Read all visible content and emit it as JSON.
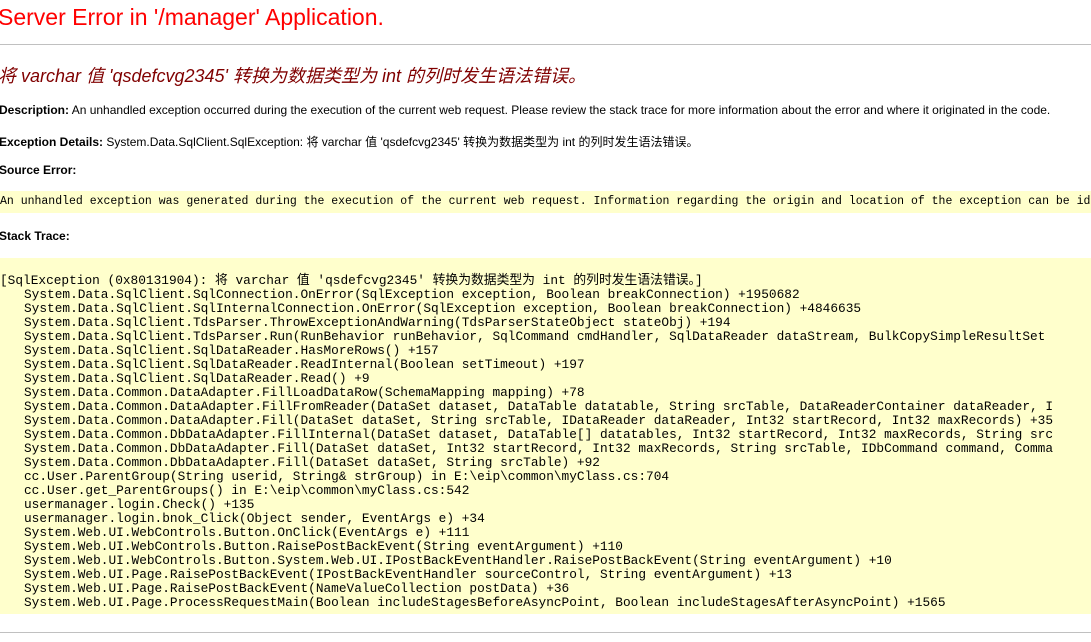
{
  "page": {
    "title": "Server Error in '/manager' Application.",
    "error_heading": "将 varchar 值 'qsdefcvg2345' 转换为数据类型为 int 的列时发生语法错误。",
    "colors": {
      "title": "#ff0000",
      "heading": "#800000",
      "code_background": "#ffffcc",
      "rule": "#c0c0c0"
    }
  },
  "description": {
    "label": "Description:",
    "text": " An unhandled exception occurred during the execution of the current web request. Please review the stack trace for more information about the error and where it originated in the code."
  },
  "exception_details": {
    "label": "Exception Details:",
    "text": " System.Data.SqlClient.SqlException: 将 varchar 值 'qsdefcvg2345' 转换为数据类型为 int 的列时发生语法错误。"
  },
  "source_error": {
    "label": "Source Error:",
    "text": "An unhandled exception was generated during the execution of the current web request. Information regarding the origin and location of the exception can be identified using the exception stack trace below."
  },
  "stack_trace": {
    "label": "Stack Trace:",
    "header": "[SqlException (0x80131904): 将 varchar 值 'qsdefcvg2345' 转换为数据类型为 int 的列时发生语法错误。]",
    "frames": [
      "System.Data.SqlClient.SqlConnection.OnError(SqlException exception, Boolean breakConnection) +1950682",
      "System.Data.SqlClient.SqlInternalConnection.OnError(SqlException exception, Boolean breakConnection) +4846635",
      "System.Data.SqlClient.TdsParser.ThrowExceptionAndWarning(TdsParserStateObject stateObj) +194",
      "System.Data.SqlClient.TdsParser.Run(RunBehavior runBehavior, SqlCommand cmdHandler, SqlDataReader dataStream, BulkCopySimpleResultSet",
      "System.Data.SqlClient.SqlDataReader.HasMoreRows() +157",
      "System.Data.SqlClient.SqlDataReader.ReadInternal(Boolean setTimeout) +197",
      "System.Data.SqlClient.SqlDataReader.Read() +9",
      "System.Data.Common.DataAdapter.FillLoadDataRow(SchemaMapping mapping) +78",
      "System.Data.Common.DataAdapter.FillFromReader(DataSet dataset, DataTable datatable, String srcTable, DataReaderContainer dataReader, I",
      "System.Data.Common.DataAdapter.Fill(DataSet dataSet, String srcTable, IDataReader dataReader, Int32 startRecord, Int32 maxRecords) +35",
      "System.Data.Common.DbDataAdapter.FillInternal(DataSet dataset, DataTable[] datatables, Int32 startRecord, Int32 maxRecords, String src",
      "System.Data.Common.DbDataAdapter.Fill(DataSet dataSet, Int32 startRecord, Int32 maxRecords, String srcTable, IDbCommand command, Comma",
      "System.Data.Common.DbDataAdapter.Fill(DataSet dataSet, String srcTable) +92",
      "cc.User.ParentGroup(String userid, String& strGroup) in E:\\eip\\common\\myClass.cs:704",
      "cc.User.get_ParentGroups() in E:\\eip\\common\\myClass.cs:542",
      "usermanager.login.Check() +135",
      "usermanager.login.bnok_Click(Object sender, EventArgs e) +34",
      "System.Web.UI.WebControls.Button.OnClick(EventArgs e) +111",
      "System.Web.UI.WebControls.Button.RaisePostBackEvent(String eventArgument) +110",
      "System.Web.UI.WebControls.Button.System.Web.UI.IPostBackEventHandler.RaisePostBackEvent(String eventArgument) +10",
      "System.Web.UI.Page.RaisePostBackEvent(IPostBackEventHandler sourceControl, String eventArgument) +13",
      "System.Web.UI.Page.RaisePostBackEvent(NameValueCollection postData) +36",
      "System.Web.UI.Page.ProcessRequestMain(Boolean includeStagesBeforeAsyncPoint, Boolean includeStagesAfterAsyncPoint) +1565"
    ]
  }
}
